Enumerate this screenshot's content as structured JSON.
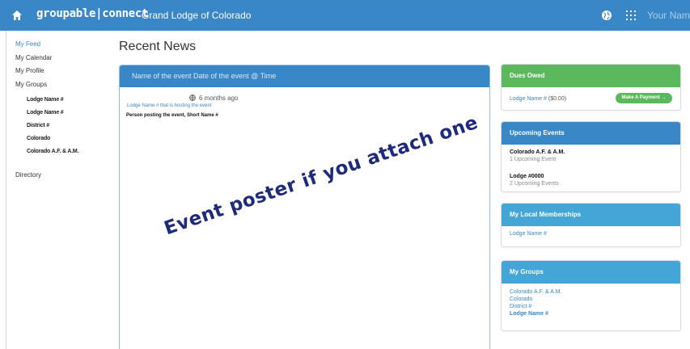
{
  "topbar": {
    "brand": "groupable|connect",
    "org_name": "Grand Lodge of Colorado",
    "user_name": "Your Name"
  },
  "sidebar": {
    "nav": [
      {
        "label": "My Feed",
        "active": true
      },
      {
        "label": "My Calendar",
        "active": false
      },
      {
        "label": "My Profile",
        "active": false
      },
      {
        "label": "My Groups",
        "active": false
      }
    ],
    "groups": [
      "Lodge Name #",
      "Lodge Name #",
      "District #",
      "Colorado",
      "Colorado A.F. & A.M."
    ],
    "directory": "Directory"
  },
  "main": {
    "title": "Recent News",
    "post": {
      "header": "Name of the event Date of the event @ Time",
      "time_ago": "6 months ago",
      "host": "Lodge Name # that is hosting the event",
      "poster": "Person posting the event, Short Name #",
      "caption": "Event poster if you attach one"
    }
  },
  "dues_panel": {
    "title": "Dues Owed",
    "lodge": "Lodge Name #",
    "amount": "($0.00)",
    "button": "Make A Payment →"
  },
  "events_panel": {
    "title": "Upcoming Events",
    "items": [
      {
        "name": "Colorado A.F. & A.M.",
        "count": "1 Upcoming Event"
      },
      {
        "name": "Lodge #0000",
        "count": "2 Upcoming Events"
      }
    ]
  },
  "memberships_panel": {
    "title": "My Local Memberships",
    "item": "Lodge Name #"
  },
  "groups_panel": {
    "title": "My Groups",
    "items": [
      "Colorado A.F. & A.M.",
      "Colorado",
      "District  #",
      "Lodge Name #"
    ]
  },
  "colors": {
    "brand_blue": "#3a87c7",
    "light_blue": "#43a6d6",
    "green": "#5cb85c",
    "caption_navy": "#1f2a7a"
  },
  "icons": [
    "home-icon",
    "globe-icon",
    "apps-grid-icon"
  ]
}
